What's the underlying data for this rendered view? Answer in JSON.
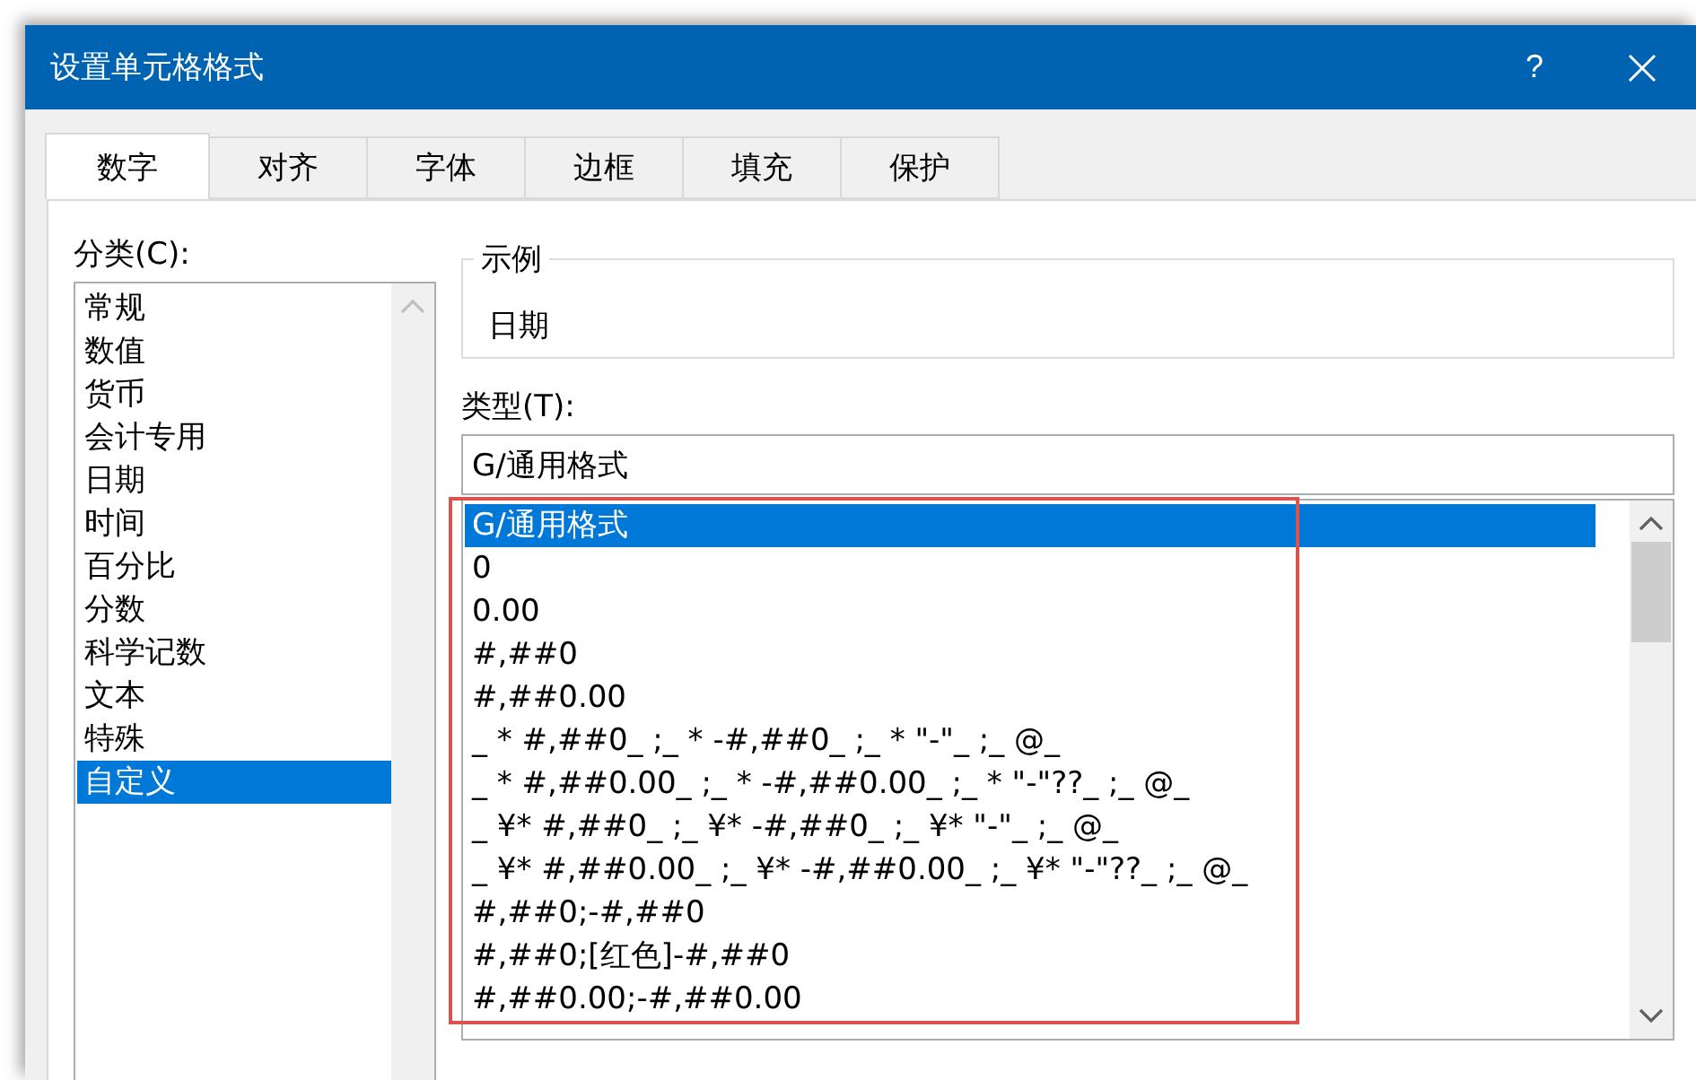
{
  "window": {
    "title": "设置单元格格式",
    "help": "?"
  },
  "tabs": [
    {
      "label": "数字",
      "selected": true
    },
    {
      "label": "对齐",
      "selected": false
    },
    {
      "label": "字体",
      "selected": false
    },
    {
      "label": "边框",
      "selected": false
    },
    {
      "label": "填充",
      "selected": false
    },
    {
      "label": "保护",
      "selected": false
    }
  ],
  "category": {
    "label": "分类(C):",
    "items": [
      {
        "label": "常规",
        "selected": false
      },
      {
        "label": "数值",
        "selected": false
      },
      {
        "label": "货币",
        "selected": false
      },
      {
        "label": "会计专用",
        "selected": false
      },
      {
        "label": "日期",
        "selected": false
      },
      {
        "label": "时间",
        "selected": false
      },
      {
        "label": "百分比",
        "selected": false
      },
      {
        "label": "分数",
        "selected": false
      },
      {
        "label": "科学记数",
        "selected": false
      },
      {
        "label": "文本",
        "selected": false
      },
      {
        "label": "特殊",
        "selected": false
      },
      {
        "label": "自定义",
        "selected": true
      }
    ]
  },
  "sample": {
    "label": "示例",
    "value": "日期"
  },
  "type": {
    "label": "类型(T):",
    "value": "G/通用格式",
    "items": [
      {
        "label": "G/通用格式",
        "selected": true
      },
      {
        "label": "0",
        "selected": false
      },
      {
        "label": "0.00",
        "selected": false
      },
      {
        "label": "#,##0",
        "selected": false
      },
      {
        "label": "#,##0.00",
        "selected": false
      },
      {
        "label": "_ * #,##0_ ;_ * -#,##0_ ;_ * \"-\"_ ;_ @_",
        "selected": false
      },
      {
        "label": "_ * #,##0.00_ ;_ * -#,##0.00_ ;_ * \"-\"??_ ;_ @_",
        "selected": false
      },
      {
        "label": "_ ¥* #,##0_ ;_ ¥* -#,##0_ ;_ ¥* \"-\"_ ;_ @_",
        "selected": false
      },
      {
        "label": "_ ¥* #,##0.00_ ;_ ¥* -#,##0.00_ ;_ ¥* \"-\"??_ ;_ @_",
        "selected": false
      },
      {
        "label": "#,##0;-#,##0",
        "selected": false
      },
      {
        "label": "#,##0;[红色]-#,##0",
        "selected": false
      },
      {
        "label": "#,##0.00;-#,##0.00",
        "selected": false
      }
    ]
  }
}
